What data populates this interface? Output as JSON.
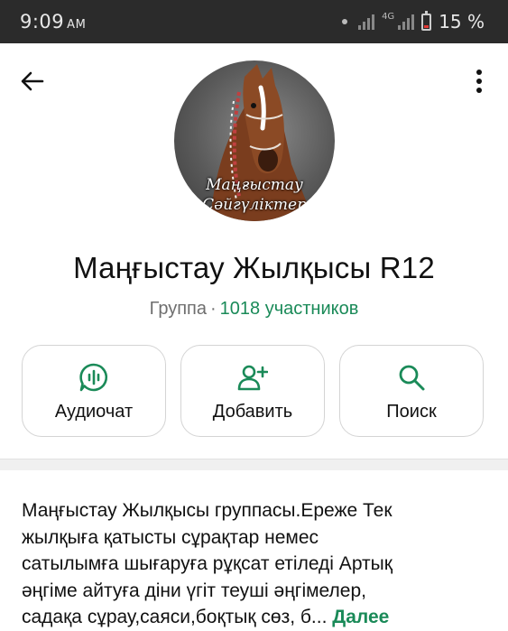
{
  "status_bar": {
    "time": "9:09",
    "ampm": "AM",
    "network_label": "4G",
    "battery_percent": "15 %",
    "battery_level": 0.15
  },
  "header": {
    "back_icon": "arrow-left-icon",
    "menu_icon": "more-vertical-icon"
  },
  "avatar": {
    "caption_line1": "Маңғыстау",
    "caption_line2": "Сәйгүліктер"
  },
  "group": {
    "title": "Маңғыстау Жылқысы R12",
    "type": "Группа",
    "separator": "·",
    "members": "1018 участников"
  },
  "actions": [
    {
      "label": "Аудиочат",
      "icon": "audio-chat-icon"
    },
    {
      "label": "Добавить",
      "icon": "add-person-icon"
    },
    {
      "label": "Поиск",
      "icon": "search-icon"
    }
  ],
  "description": {
    "lines": [
      "Маңғыстау Жылқысы группасы.Ереже Тек",
      "жылқыға қатысты сұрақтар немес",
      "сатылымға шығаруға рұқсат етіледі Артық",
      "әңгіме айтуға діни үгіт теуші әңгімелер,",
      "садақа сұрау,саяси,боқтық сөз, б..."
    ],
    "more_label": "Далее"
  },
  "colors": {
    "accent": "#1a8a58",
    "status_bar": "#2b2b2b",
    "battery_low": "#e53935"
  }
}
